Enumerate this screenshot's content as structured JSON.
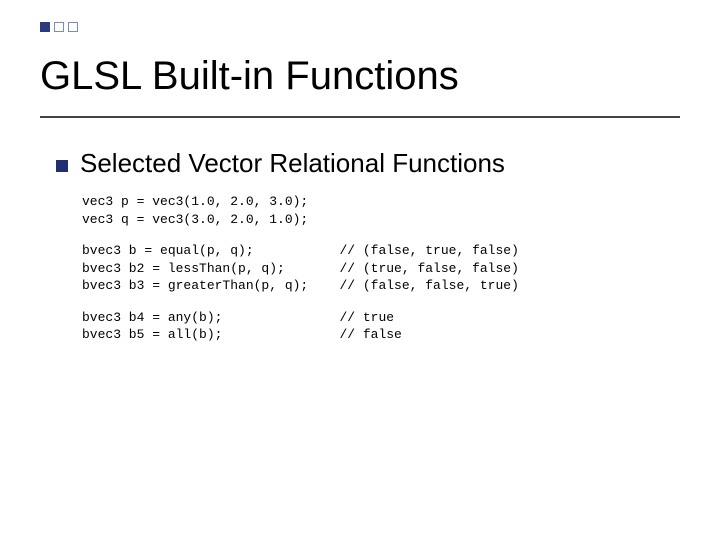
{
  "title": "GLSL Built-in Functions",
  "bullet": "Selected Vector Relational Functions",
  "code_block1": "vec3 p = vec3(1.0, 2.0, 3.0);\nvec3 q = vec3(3.0, 2.0, 1.0);",
  "code_block2": "bvec3 b = equal(p, q);           // (false, true, false)\nbvec3 b2 = lessThan(p, q);       // (true, false, false)\nbvec3 b3 = greaterThan(p, q);    // (false, false, true)",
  "code_block3": "bvec3 b4 = any(b);               // true\nbvec3 b5 = all(b);               // false"
}
